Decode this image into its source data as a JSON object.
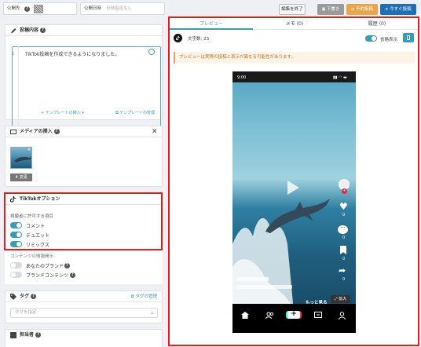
{
  "topbar": {
    "account_label": "公開先",
    "date_label": "公開日時",
    "date_placeholder": "日時指定なし",
    "edit_end_label": "編集を終了",
    "draft_label": "下書き",
    "schedule_label": "予約投稿",
    "post_now_label": "今すぐ投稿"
  },
  "post_content": {
    "title": "投稿内容",
    "line_number": "1",
    "text": "TikTok投稿を作成できるようになりました。",
    "template_insert": "テンプレートの挿入",
    "template_manage": "テンプレートの管理"
  },
  "media": {
    "title": "メディアの挿入",
    "change_label": "変更"
  },
  "tiktok_options": {
    "title": "TikTokオプション",
    "allow_label": "視聴者に許可する項目",
    "items": [
      {
        "label": "コメント",
        "on": true
      },
      {
        "label": "デュエット",
        "on": true
      },
      {
        "label": "リミックス",
        "on": true
      }
    ]
  },
  "content_disclosure": {
    "title": "コンテンツの情報開示",
    "items": [
      {
        "label": "あなたのブランド",
        "on": false
      },
      {
        "label": "ブランドコンテンツ",
        "on": false
      }
    ]
  },
  "tags": {
    "title": "タグ",
    "manage_label": "タグの管理",
    "placeholder": "タグを指定"
  },
  "assignee": {
    "title": "担当者"
  },
  "preview": {
    "tabs": [
      {
        "label": "プレビュー",
        "active": true
      },
      {
        "label": "メモ (0)",
        "active": false
      },
      {
        "label": "履歴 (0)",
        "active": false
      }
    ],
    "char_count": "文字数: 23",
    "abbreviate_label": "省略表示",
    "warning": "プレビューは実際の投稿と表示が異なる可能性があります。",
    "phone_time": "9:00",
    "side_counts": [
      "0",
      "0",
      "0",
      "0"
    ],
    "more_label": "もっと見る",
    "expand_label": "拡大"
  },
  "colors": {
    "accent": "#3a9bb5",
    "post_now": "#1e6fb8",
    "highlight_border": "#e02020",
    "warning_bg": "#fdf3e6",
    "warning_text": "#c0721e"
  }
}
